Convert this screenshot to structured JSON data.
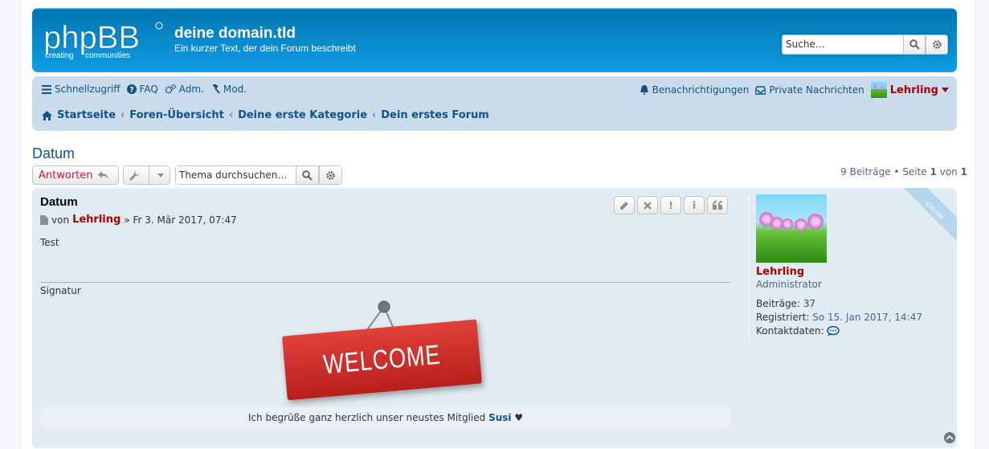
{
  "header": {
    "logo_text": "phpBB",
    "logo_tagline_1": "creating",
    "logo_tagline_2": "communities",
    "site_title": "deine domain.tld",
    "site_description": "Ein kurzer Text, der dein Forum beschreibt",
    "search_placeholder": "Suche…"
  },
  "navbar": {
    "quicklinks": "Schnellzugriff",
    "faq": "FAQ",
    "acp": "Adm.",
    "mcp": "Mod.",
    "notifications": "Benachrichtigungen",
    "private_messages": "Private Nachrichten",
    "username": "Lehrling"
  },
  "breadcrumb": {
    "items": [
      "Startseite",
      "Foren-Übersicht",
      "Deine erste Kategorie",
      "Dein erstes Forum"
    ]
  },
  "topic": {
    "title": "Datum",
    "reply_label": "Antworten",
    "search_placeholder": "Thema durchsuchen…",
    "pagination": {
      "posts_count": "9",
      "posts_label": "Beiträge",
      "bullet": "•",
      "page_label": "Seite",
      "page": "1",
      "of_label": "von",
      "total_pages": "1"
    }
  },
  "post": {
    "title": "Datum",
    "by_label": "von",
    "author": "Lehrling",
    "date": "» Fr 3. Mär 2017, 07:47",
    "body": "Test",
    "signature_label": "Signatur",
    "welcome_banner": "WELCOME",
    "welcome_note_prefix": "Ich begrüße ganz herzlich unser neustes Mitglied",
    "welcome_note_member": "Susi",
    "welcome_note_suffix": "♥",
    "online_badge": "ONLINE",
    "buttons": {
      "edit": "edit",
      "delete": "delete",
      "report": "!",
      "info": "i",
      "quote": "quote"
    }
  },
  "profile": {
    "name": "Lehrling",
    "rank": "Administrator",
    "posts_label": "Beiträge:",
    "posts_value": "37",
    "joined_label": "Registriert:",
    "joined_value": "So 15. Jan 2017, 14:47",
    "contact_label": "Kontaktdaten:"
  },
  "colors": {
    "header_blue": "#12a3eb",
    "nav_bg": "#cadceb",
    "post_bg": "#e1ebf2",
    "link": "#105289",
    "admin_red": "#aa0000",
    "reply_red": "#d31141"
  }
}
